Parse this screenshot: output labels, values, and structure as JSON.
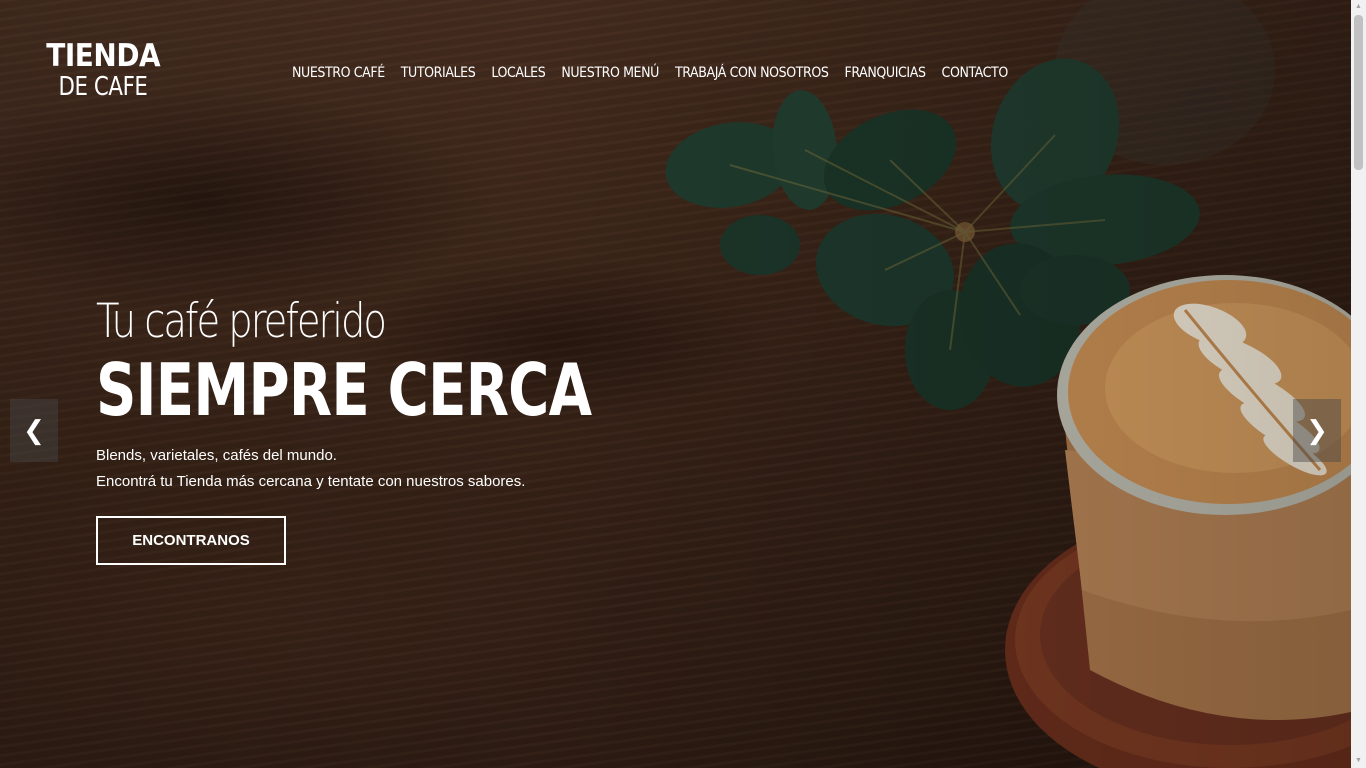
{
  "brand": {
    "line1": "TIENDA",
    "line2": "DE CAFE"
  },
  "nav": {
    "items": [
      {
        "label": "NUESTRO CAFÉ"
      },
      {
        "label": "TUTORIALES"
      },
      {
        "label": "LOCALES"
      },
      {
        "label": "NUESTRO MENÚ"
      },
      {
        "label": "TRABAJÁ CON NOSOTROS"
      },
      {
        "label": "FRANQUICIAS"
      },
      {
        "label": "CONTACTO"
      }
    ]
  },
  "hero": {
    "subtitle": "Tu café preferido",
    "title": "SIEMPRE CERCA",
    "line1": "Blends, varietales, cafés del mundo.",
    "line2": "Encontrá tu Tienda más cercana y tentate con nuestros sabores.",
    "cta": "ENCONTRANOS"
  },
  "carousel": {
    "prev_icon": "chevron-left-icon",
    "next_icon": "chevron-right-icon",
    "prev": "❮",
    "next": "❯"
  },
  "colors": {
    "text": "#ffffff",
    "wood": "#3a2418",
    "crema": "#c98f54",
    "leaf": "#243d30",
    "saucer": "#7a3a22"
  }
}
